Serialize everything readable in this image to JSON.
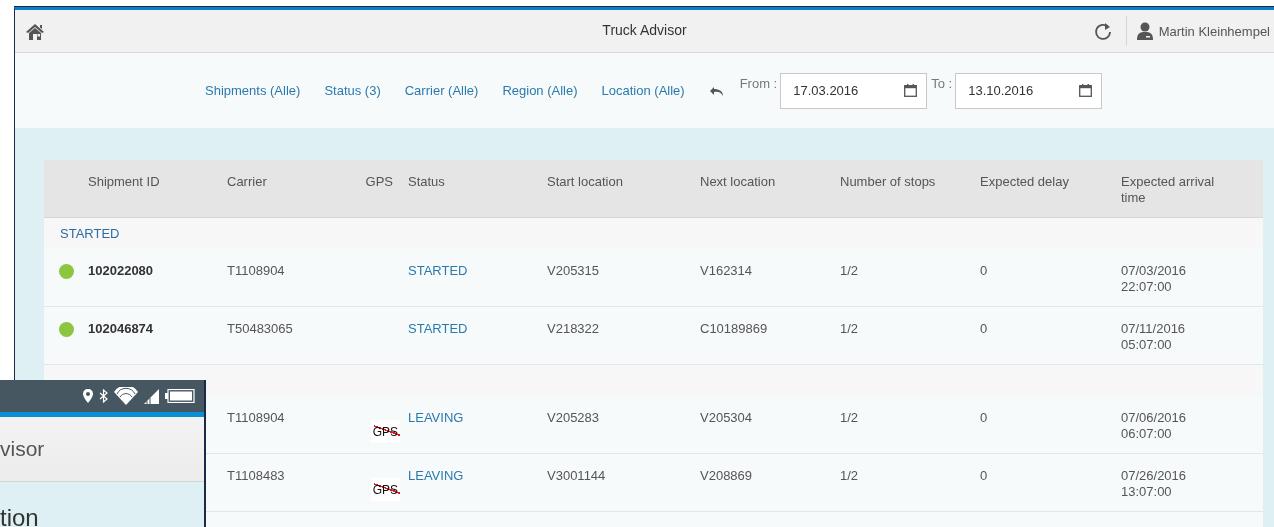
{
  "window": {
    "title": "Truck Advisor",
    "user": "Martin Kleinhempel"
  },
  "filters": [
    "Shipments (Alle)",
    "Status (3)",
    "Carrier (Alle)",
    "Region (Alle)",
    "Location (Alle)"
  ],
  "date_range": {
    "from_label": "From :",
    "from": "17.03.2016",
    "to_label": "To :",
    "to": "13.10.2016"
  },
  "table": {
    "columns": [
      "Shipment ID",
      "Carrier",
      "GPS",
      "Status",
      "Start location",
      "Next location",
      "Number of stops",
      "Expected delay",
      "Expected arrival time"
    ],
    "groups": [
      {
        "label": "STARTED",
        "rows": [
          {
            "color": "#8cc63f",
            "shipment_id": "102022080",
            "carrier": "T1108904",
            "status": "STARTED",
            "start": "V205315",
            "next": "V162314",
            "stops": "1/2",
            "delay": "0",
            "arrival": [
              "07/03/2016",
              "22:07:00"
            ]
          },
          {
            "color": "#8cc63f",
            "shipment_id": "102046874",
            "carrier": "T50483065",
            "status": "STARTED",
            "start": "V218322",
            "next": "C10189869",
            "stops": "1/2",
            "delay": "0",
            "arrival": [
              "07/11/2016",
              "05:07:00"
            ]
          }
        ]
      },
      {
        "rows": [
          {
            "carrier": "T1108904",
            "gps": {
              "label": "GPS",
              "lost": true
            },
            "status": "LEAVING",
            "start": "V205283",
            "next": "V205304",
            "stops": "1/2",
            "delay": "0",
            "arrival": [
              "07/06/2016",
              "06:07:00"
            ]
          },
          {
            "carrier": "T1108483",
            "gps": {
              "label": "GPS",
              "lost": true
            },
            "status": "LEAVING",
            "start": "V3001144",
            "next": "V208869",
            "stops": "1/2",
            "delay": "0",
            "arrival": [
              "07/26/2016",
              "13:07:00"
            ]
          }
        ]
      }
    ]
  },
  "phone": {
    "title": "visor",
    "heading": "tion"
  }
}
